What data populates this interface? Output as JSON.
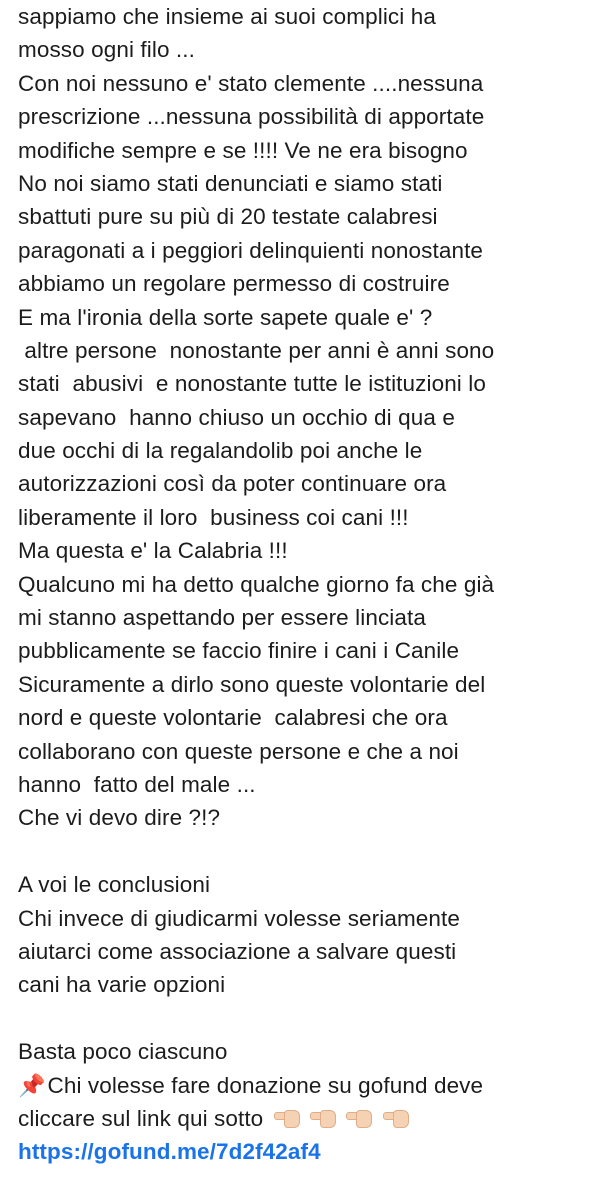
{
  "post": {
    "lines": [
      "sappiamo che insieme ai suoi complici ha",
      "mosso ogni filo ...",
      "Con noi nessuno e' stato clemente ....nessuna",
      "prescrizione ...nessuna possibilità di apportate",
      "modifiche sempre e se !!!! Ve ne era bisogno",
      "No noi siamo stati  denunciati  e siamo stati",
      "sbattuti pure su più di 20 testate calabresi",
      "paragonati a i peggiori delinquienti nonostante",
      "abbiamo un regolare permesso di costruire",
      "E ma l'ironia della sorte sapete quale e' ?",
      " altre persone  nonostante per anni è anni sono",
      "stati  abusivi  e nonostante tutte le istituzioni lo",
      "sapevano  hanno chiuso un occhio di qua e",
      "due occhi di la regalandolib poi anche le",
      "autorizzazioni così da poter continuare ora",
      "liberamente il loro  business coi cani !!!",
      "Ma questa e' la Calabria !!!",
      "Qualcuno mi ha detto qualche giorno fa che già",
      "mi stanno aspettando per essere linciata",
      "pubblicamente se faccio finire i cani i Canile",
      "Sicuramente a dirlo sono queste volontarie del",
      "nord e queste volontarie  calabresi che ora",
      "collaborano con queste persone e che a noi",
      "hanno  fatto del male ...",
      "Che vi devo dire ?!?"
    ],
    "conclusion_lines": [
      "A voi le conclusioni",
      "Chi invece di giudicarmi volesse seriamente",
      "aiutarci come associazione a salvare questi",
      "cani ha varie opzioni"
    ],
    "closing_line": "Basta poco ciascuno",
    "donation_line_1": "Chi volesse fare donazione su gofund deve",
    "donation_line_2": "cliccare sul link qui sotto",
    "pin_icon": "pushpin-icon",
    "hand_icon": "backhand-index-pointing-right-icon",
    "link_text": "https://gofund.me/7d2f42af4",
    "link_color": "#1a73e8"
  }
}
